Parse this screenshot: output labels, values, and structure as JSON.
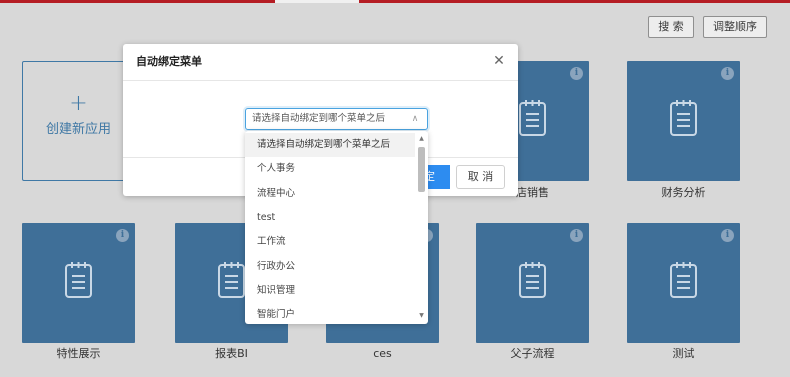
{
  "header": {
    "search_label": "搜 索",
    "order_label": "调整顺序"
  },
  "create_card": {
    "plus": "+",
    "label": "创建新应用"
  },
  "tiles_row1": [
    {
      "label": ""
    },
    {
      "label": ""
    },
    {
      "label": "店销售"
    },
    {
      "label": "财务分析"
    }
  ],
  "tiles_row2": [
    {
      "label": "特性展示"
    },
    {
      "label": "报表BI"
    },
    {
      "label": "ces"
    },
    {
      "label": "父子流程"
    },
    {
      "label": "测试"
    }
  ],
  "tile_info_glyph": "i",
  "modal": {
    "title": "自动绑定菜单",
    "close_glyph": "✕",
    "select_value": "请选择自动绑定到哪个菜单之后",
    "select_arrow": "∧",
    "ok_label": "定",
    "cancel_label": "取 消"
  },
  "dropdown": {
    "items": [
      "请选择自动绑定到哪个菜单之后",
      "个人事务",
      "流程中心",
      "test",
      "工作流",
      "行政办公",
      "知识管理",
      "智能门户"
    ],
    "scroll_up": "▲",
    "scroll_down": "▼"
  },
  "colors": {
    "tile": "#3f6f98",
    "accent": "#2d8cf0",
    "topbar": "#b51d24"
  }
}
